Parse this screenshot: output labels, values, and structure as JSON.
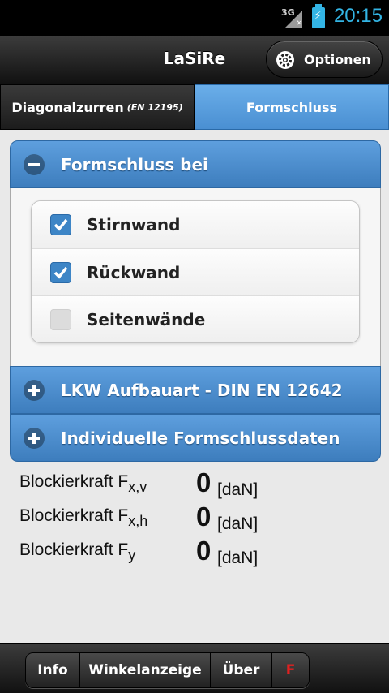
{
  "status_bar": {
    "network": "3G",
    "time": "20:15"
  },
  "header": {
    "title": "LaSiRe",
    "options_label": "Optionen"
  },
  "tabs": [
    {
      "label": "Diagonalzurren",
      "sub": "(EN 12195)",
      "active": false
    },
    {
      "label": "Formschluss",
      "active": true
    }
  ],
  "sections": [
    {
      "title": "Formschluss bei",
      "expanded": true,
      "items": [
        {
          "label": "Stirnwand",
          "checked": true
        },
        {
          "label": "Rückwand",
          "checked": true
        },
        {
          "label": "Seitenwände",
          "checked": false
        }
      ]
    },
    {
      "title": "LKW Aufbauart - DIN EN 12642",
      "expanded": false
    },
    {
      "title": "Individuelle Formschlussdaten",
      "expanded": false
    }
  ],
  "results": [
    {
      "label": "Blockierkraft F",
      "sub": "x,v",
      "value": "0",
      "unit": "[daN]"
    },
    {
      "label": "Blockierkraft F",
      "sub": "x,h",
      "value": "0",
      "unit": "[daN]"
    },
    {
      "label": "Blockierkraft F",
      "sub": "y",
      "value": "0",
      "unit": "[daN]"
    }
  ],
  "footer": {
    "nav": [
      "Info",
      "Winkelanzeige",
      "Über",
      "F"
    ]
  },
  "colors": {
    "accent": "#4a8fd2",
    "status_time": "#33b5e5",
    "f_button": "#e02020"
  }
}
